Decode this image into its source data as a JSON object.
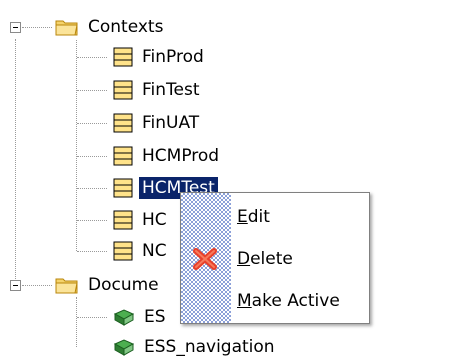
{
  "tree": {
    "contexts_label": "Contexts",
    "contexts": [
      "FinProd",
      "FinTest",
      "FinUAT",
      "HCMProd",
      "HCMTest",
      "HC",
      "NC"
    ],
    "selected": "HCMTest",
    "documents_label": "Docume",
    "documents": [
      "ES",
      "ESS_navigation"
    ]
  },
  "context_menu": {
    "items": [
      {
        "mnemonic": "E",
        "rest": "dit",
        "icon": "none"
      },
      {
        "mnemonic": "D",
        "rest": "elete",
        "icon": "red-x-icon"
      },
      {
        "mnemonic": "M",
        "rest": "ake Active",
        "icon": "none"
      }
    ]
  },
  "colors": {
    "selection": "#0a246a",
    "menu_strip": "#8ca0d8",
    "folder": "#f5d36b",
    "delete": "#e8402a"
  }
}
